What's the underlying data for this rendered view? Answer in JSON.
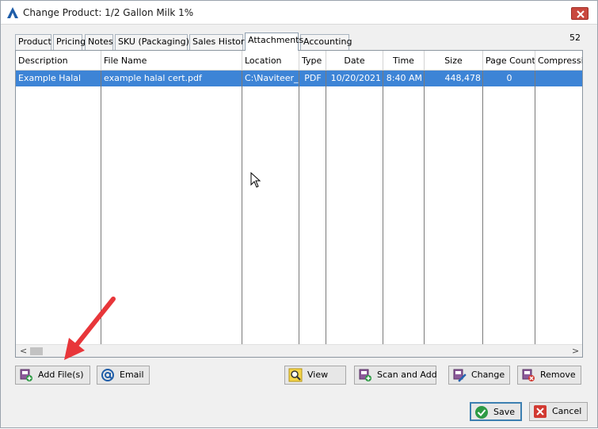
{
  "window": {
    "title": "Change Product: 1/2 Gallon Milk 1%"
  },
  "tabs": [
    "Product",
    "Pricing",
    "Notes",
    "SKU (Packaging)",
    "Sales History",
    "Attachments",
    "Accounting"
  ],
  "active_tab": "Attachments",
  "counter": "52",
  "columns": [
    "Description",
    "File Name",
    "Location",
    "Type",
    "Date",
    "Time",
    "Size",
    "Page Count",
    "Compression"
  ],
  "rows": [
    {
      "description": "Example Halal",
      "file_name": "example halal cert.pdf",
      "location": "C:\\Naviteer_B",
      "type": "PDF",
      "date": "10/20/2021",
      "time": "8:40 AM",
      "size": "448,478",
      "page_count": "0",
      "compression": ""
    }
  ],
  "scrollbar": {
    "left_arrow": "<",
    "right_arrow": ">"
  },
  "buttons": {
    "add_files": "Add File(s)",
    "email": "Email",
    "view": "View",
    "scan_and_add": "Scan and Add",
    "change": "Change",
    "remove": "Remove",
    "save": "Save",
    "cancel": "Cancel"
  },
  "colors": {
    "selection": "#3d84d6",
    "annotation_arrow": "#e8363a",
    "save_check": "#2e9a45",
    "cancel_x": "#d23a32"
  },
  "icons": {
    "app": "naviteer-logo-icon",
    "close": "close-icon",
    "add": "add-file-icon",
    "email": "at-sign-icon",
    "view": "magnifier-icon",
    "scan": "scanner-icon",
    "change": "edit-pencil-icon",
    "remove": "remove-file-icon",
    "save": "checkmark-icon",
    "cancel": "x-icon"
  }
}
